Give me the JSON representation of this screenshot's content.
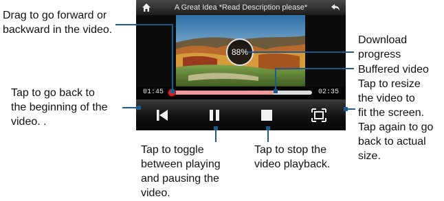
{
  "player": {
    "title": "A Great Idea *Read Description please*",
    "download_progress": "88%",
    "time_elapsed": "01:45",
    "time_total": "02:35",
    "icons": {
      "home": "home-icon",
      "back": "return-arrow-icon",
      "rewind": "skip-to-start-icon",
      "pause": "pause-icon",
      "stop": "stop-icon",
      "fullscreen": "resize-icon"
    },
    "colors": {
      "played": "#c42222",
      "buffered": "#ee9a9a",
      "callout": "#1e5a8e"
    }
  },
  "annotations": {
    "seek": "Drag to go forward or\nbackward in the video.",
    "download": "Download\nprogress",
    "buffered": "Buffered video",
    "resize": "Tap to resize\nthe video to\nfit the screen.\nTap again to go\nback to actual\nsize.",
    "rewind": "Tap to go back to\nthe beginning of the\nvideo. .",
    "pause": "Tap to toggle\nbetween playing\nand pausing the\nvideo.",
    "stop": "Tap to stop the\nvideo playback."
  }
}
